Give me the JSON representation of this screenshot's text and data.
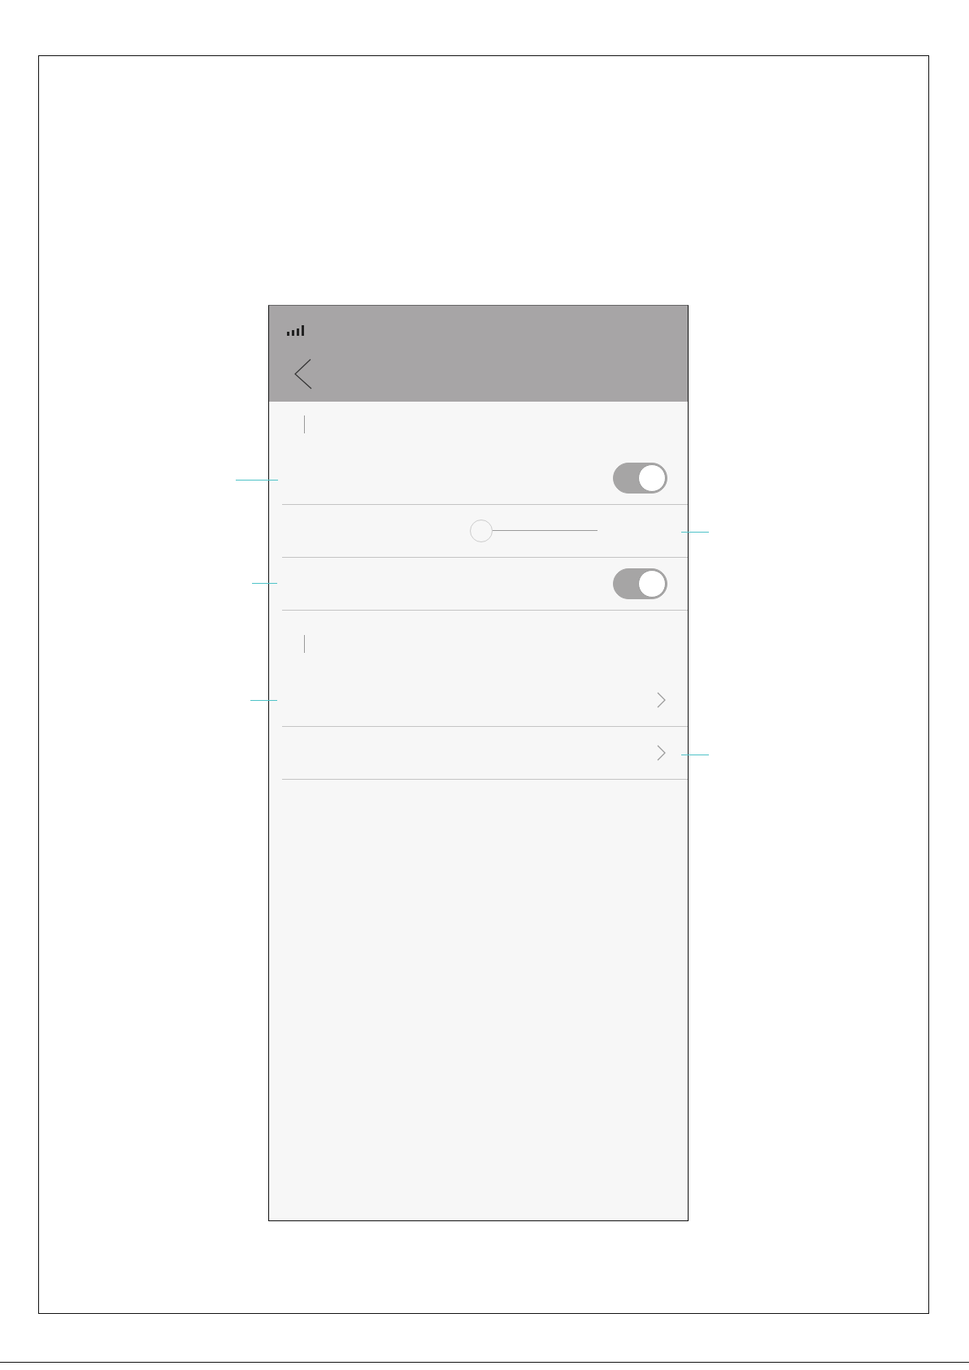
{
  "sections": [
    {
      "rows": [
        {
          "kind": "toggle",
          "on": true
        },
        {
          "kind": "slider",
          "level": 0
        },
        {
          "kind": "toggle",
          "on": true
        }
      ]
    },
    {
      "rows": [
        {
          "kind": "link"
        },
        {
          "kind": "link"
        }
      ]
    }
  ]
}
